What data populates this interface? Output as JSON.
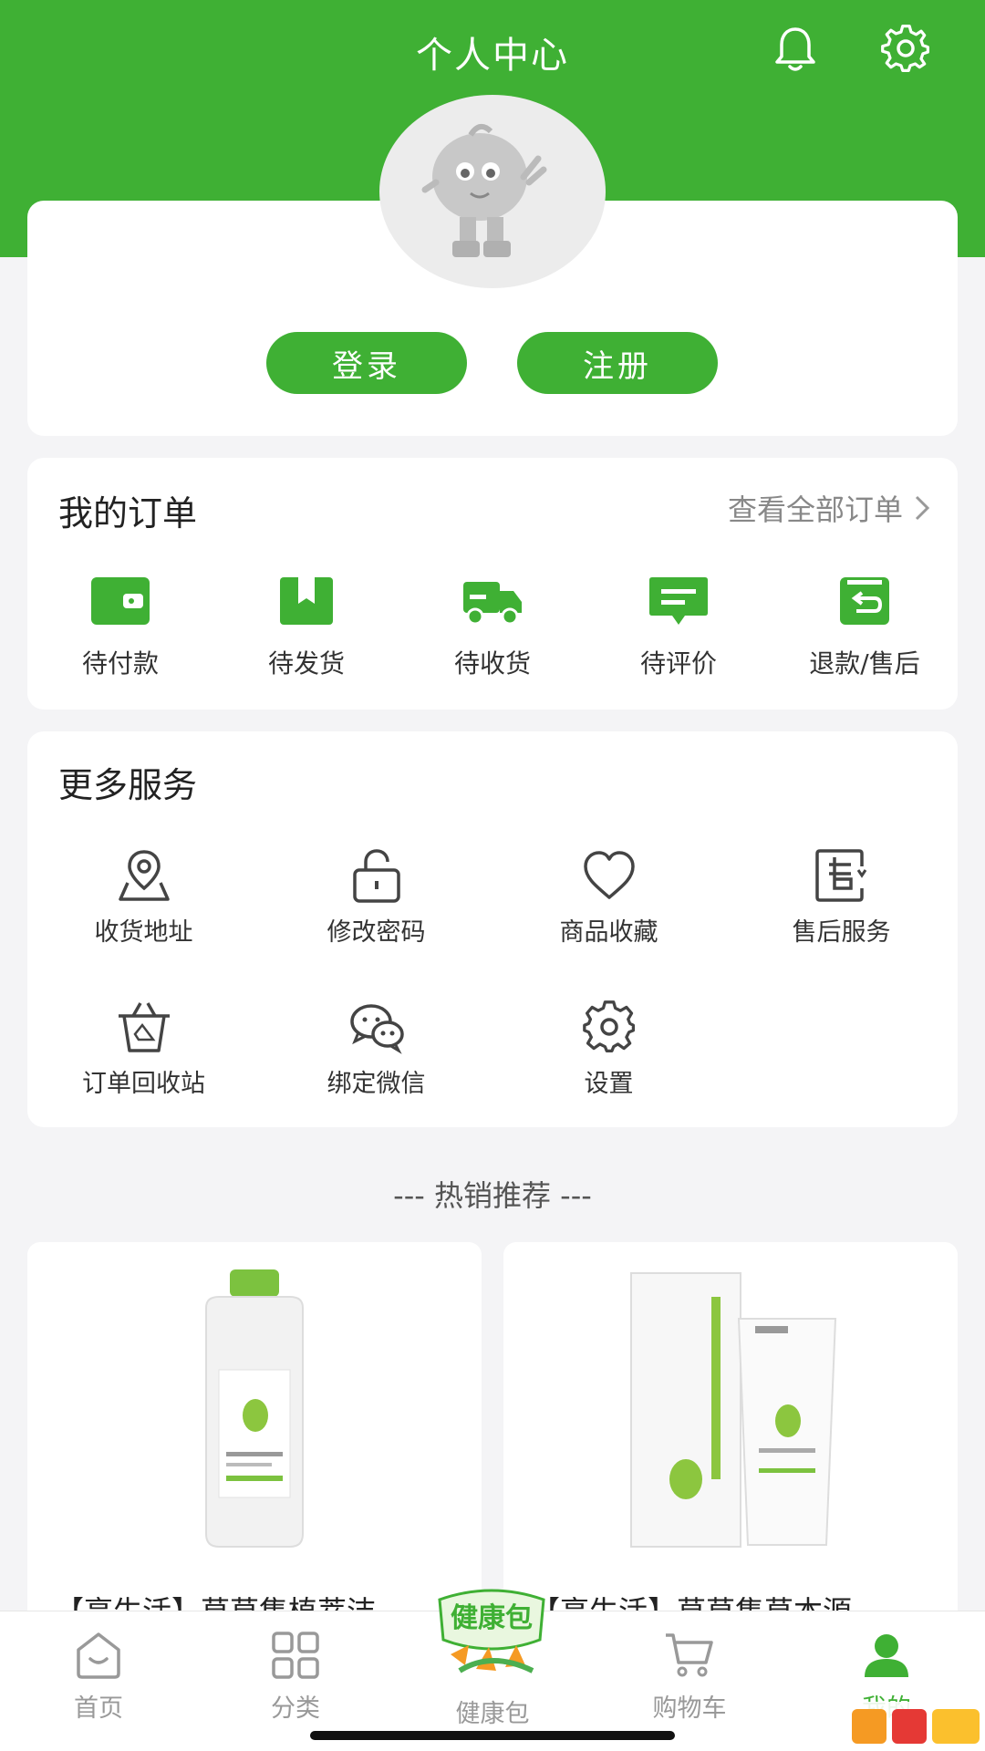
{
  "header": {
    "title": "个人中心"
  },
  "profile": {
    "login_label": "登录",
    "register_label": "注册"
  },
  "orders": {
    "title": "我的订单",
    "view_all": "查看全部订单",
    "items": [
      {
        "label": "待付款",
        "icon": "wallet-icon"
      },
      {
        "label": "待发货",
        "icon": "package-icon"
      },
      {
        "label": "待收货",
        "icon": "truck-icon"
      },
      {
        "label": "待评价",
        "icon": "comment-icon"
      },
      {
        "label": "退款/售后",
        "icon": "refund-icon"
      }
    ]
  },
  "services": {
    "title": "更多服务",
    "items": [
      {
        "label": "收货地址",
        "icon": "location-icon"
      },
      {
        "label": "修改密码",
        "icon": "lock-icon"
      },
      {
        "label": "商品收藏",
        "icon": "heart-icon"
      },
      {
        "label": "售后服务",
        "icon": "after-sales-icon"
      },
      {
        "label": "订单回收站",
        "icon": "recycle-bin-icon"
      },
      {
        "label": "绑定微信",
        "icon": "wechat-icon"
      },
      {
        "label": "设置",
        "icon": "gear-icon"
      }
    ]
  },
  "hot": {
    "title": "--- 热销推荐 ---",
    "products": [
      {
        "name": "【亮生活】草草集植萃洁"
      },
      {
        "name": "【亮生活】草草集草本源"
      }
    ]
  },
  "tabbar": {
    "items": [
      {
        "label": "首页",
        "icon": "home-icon"
      },
      {
        "label": "分类",
        "icon": "category-icon"
      },
      {
        "label": "健康包",
        "icon": "health-pack-icon"
      },
      {
        "label": "购物车",
        "icon": "cart-icon"
      },
      {
        "label": "我的",
        "icon": "user-icon",
        "active": true
      }
    ],
    "badge_text": "健康包"
  },
  "colors": {
    "brand": "#3fb034",
    "background": "#f4f4f6"
  }
}
